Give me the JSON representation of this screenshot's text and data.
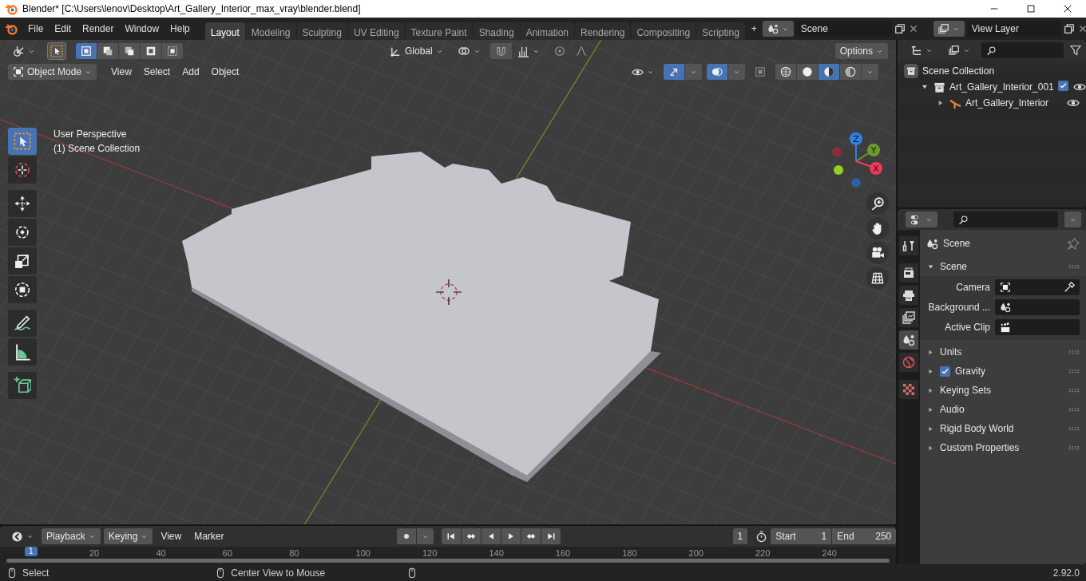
{
  "window": {
    "title": "Blender* [C:\\Users\\lenov\\Desktop\\Art_Gallery_Interior_max_vray\\blender.blend]"
  },
  "menus": [
    "File",
    "Edit",
    "Render",
    "Window",
    "Help"
  ],
  "workspaces": [
    {
      "label": "Layout",
      "selected": true
    },
    {
      "label": "Modeling",
      "selected": false
    },
    {
      "label": "Sculpting",
      "selected": false
    },
    {
      "label": "UV Editing",
      "selected": false
    },
    {
      "label": "Texture Paint",
      "selected": false
    },
    {
      "label": "Shading",
      "selected": false
    },
    {
      "label": "Animation",
      "selected": false
    },
    {
      "label": "Rendering",
      "selected": false
    },
    {
      "label": "Compositing",
      "selected": false
    },
    {
      "label": "Scripting",
      "selected": false
    }
  ],
  "add_workspace": "+",
  "scene_selector": {
    "value": "Scene"
  },
  "view_layer_selector": {
    "value": "View Layer"
  },
  "viewport": {
    "header": {
      "orientation": "Global",
      "options": "Options",
      "mode": "Object Mode",
      "menus": [
        "View",
        "Select",
        "Add",
        "Object"
      ],
      "select_modes": [
        {
          "selected": true
        },
        {
          "selected": false
        },
        {
          "selected": false
        },
        {
          "selected": false
        },
        {
          "selected": false
        }
      ],
      "snapping": {
        "on": false
      },
      "proportional_editing": {
        "on": false
      },
      "toggles": [
        {
          "kind": "gizmos",
          "on": true
        },
        {
          "kind": "overlays",
          "on": true
        },
        {
          "kind": "xray",
          "on": false
        }
      ],
      "shading": [
        {
          "kind": "wireframe",
          "selected": false
        },
        {
          "kind": "solid",
          "selected": false
        },
        {
          "kind": "material",
          "selected": true
        },
        {
          "kind": "rendered",
          "selected": false
        }
      ]
    },
    "overlay_text": [
      "User Perspective",
      "(1) Scene Collection"
    ],
    "tools": [
      {
        "kind": "select",
        "selected": true
      },
      {
        "kind": "cursor",
        "selected": false
      },
      {
        "kind": "move",
        "selected": false
      },
      {
        "kind": "rotate",
        "selected": false
      },
      {
        "kind": "scale",
        "selected": false
      },
      {
        "kind": "transform",
        "selected": false
      },
      {
        "kind": "annotate",
        "selected": false
      },
      {
        "kind": "measure",
        "selected": false
      },
      {
        "kind": "add_cube",
        "selected": false
      }
    ],
    "gizmo": [
      {
        "label": "Z",
        "color": "#2f83e3"
      },
      {
        "label": "Y",
        "color": "#6d9a2c"
      },
      {
        "label": "X",
        "color": "#f5385a"
      }
    ]
  },
  "outliner": {
    "items": [
      {
        "label": "Scene Collection",
        "kind": "scene_collection",
        "children": [
          {
            "label": "Art_Gallery_Interior_001",
            "kind": "collection",
            "expanded": true,
            "checked": true,
            "visible": true,
            "children": [
              {
                "label": "Art_Gallery_Interior",
                "kind": "object",
                "expanded": false,
                "visible": true
              }
            ]
          }
        ]
      }
    ]
  },
  "properties": {
    "tabs": [
      {
        "kind": "tool",
        "selected": false
      },
      {
        "kind": "render",
        "selected": false
      },
      {
        "kind": "output",
        "selected": false
      },
      {
        "kind": "view_layer",
        "selected": false
      },
      {
        "kind": "scene",
        "selected": true
      },
      {
        "kind": "world",
        "selected": false
      },
      {
        "kind": "texture",
        "selected": false
      }
    ],
    "context": "Scene",
    "panel": {
      "label": "Scene",
      "expanded": true,
      "fields": [
        {
          "label": "Camera",
          "kind": "camera"
        },
        {
          "label": "Background ...",
          "kind": "scene"
        },
        {
          "label": "Active Clip",
          "kind": "clip"
        }
      ]
    },
    "subpanels": [
      {
        "label": "Units",
        "kind": "plain",
        "expanded": false
      },
      {
        "label": "Gravity",
        "kind": "checkbox",
        "checked": true,
        "expanded": false
      },
      {
        "label": "Keying Sets",
        "kind": "plain",
        "expanded": false
      },
      {
        "label": "Audio",
        "kind": "plain",
        "expanded": false
      },
      {
        "label": "Rigid Body World",
        "kind": "plain",
        "expanded": false
      },
      {
        "label": "Custom Properties",
        "kind": "plain",
        "expanded": false
      }
    ]
  },
  "timeline": {
    "menus": [
      "Playback",
      "Keying",
      "View",
      "Marker"
    ],
    "current_frame": "1",
    "start_label": "Start",
    "start": "1",
    "end_label": "End",
    "end": "250",
    "ruler": {
      "current": "1",
      "ticks": [
        "20",
        "40",
        "60",
        "80",
        "100",
        "120",
        "140",
        "160",
        "180",
        "200",
        "220",
        "240"
      ]
    }
  },
  "status_bar": {
    "hints": [
      "Select",
      "Center View to Mouse"
    ],
    "version": "2.92.0"
  }
}
